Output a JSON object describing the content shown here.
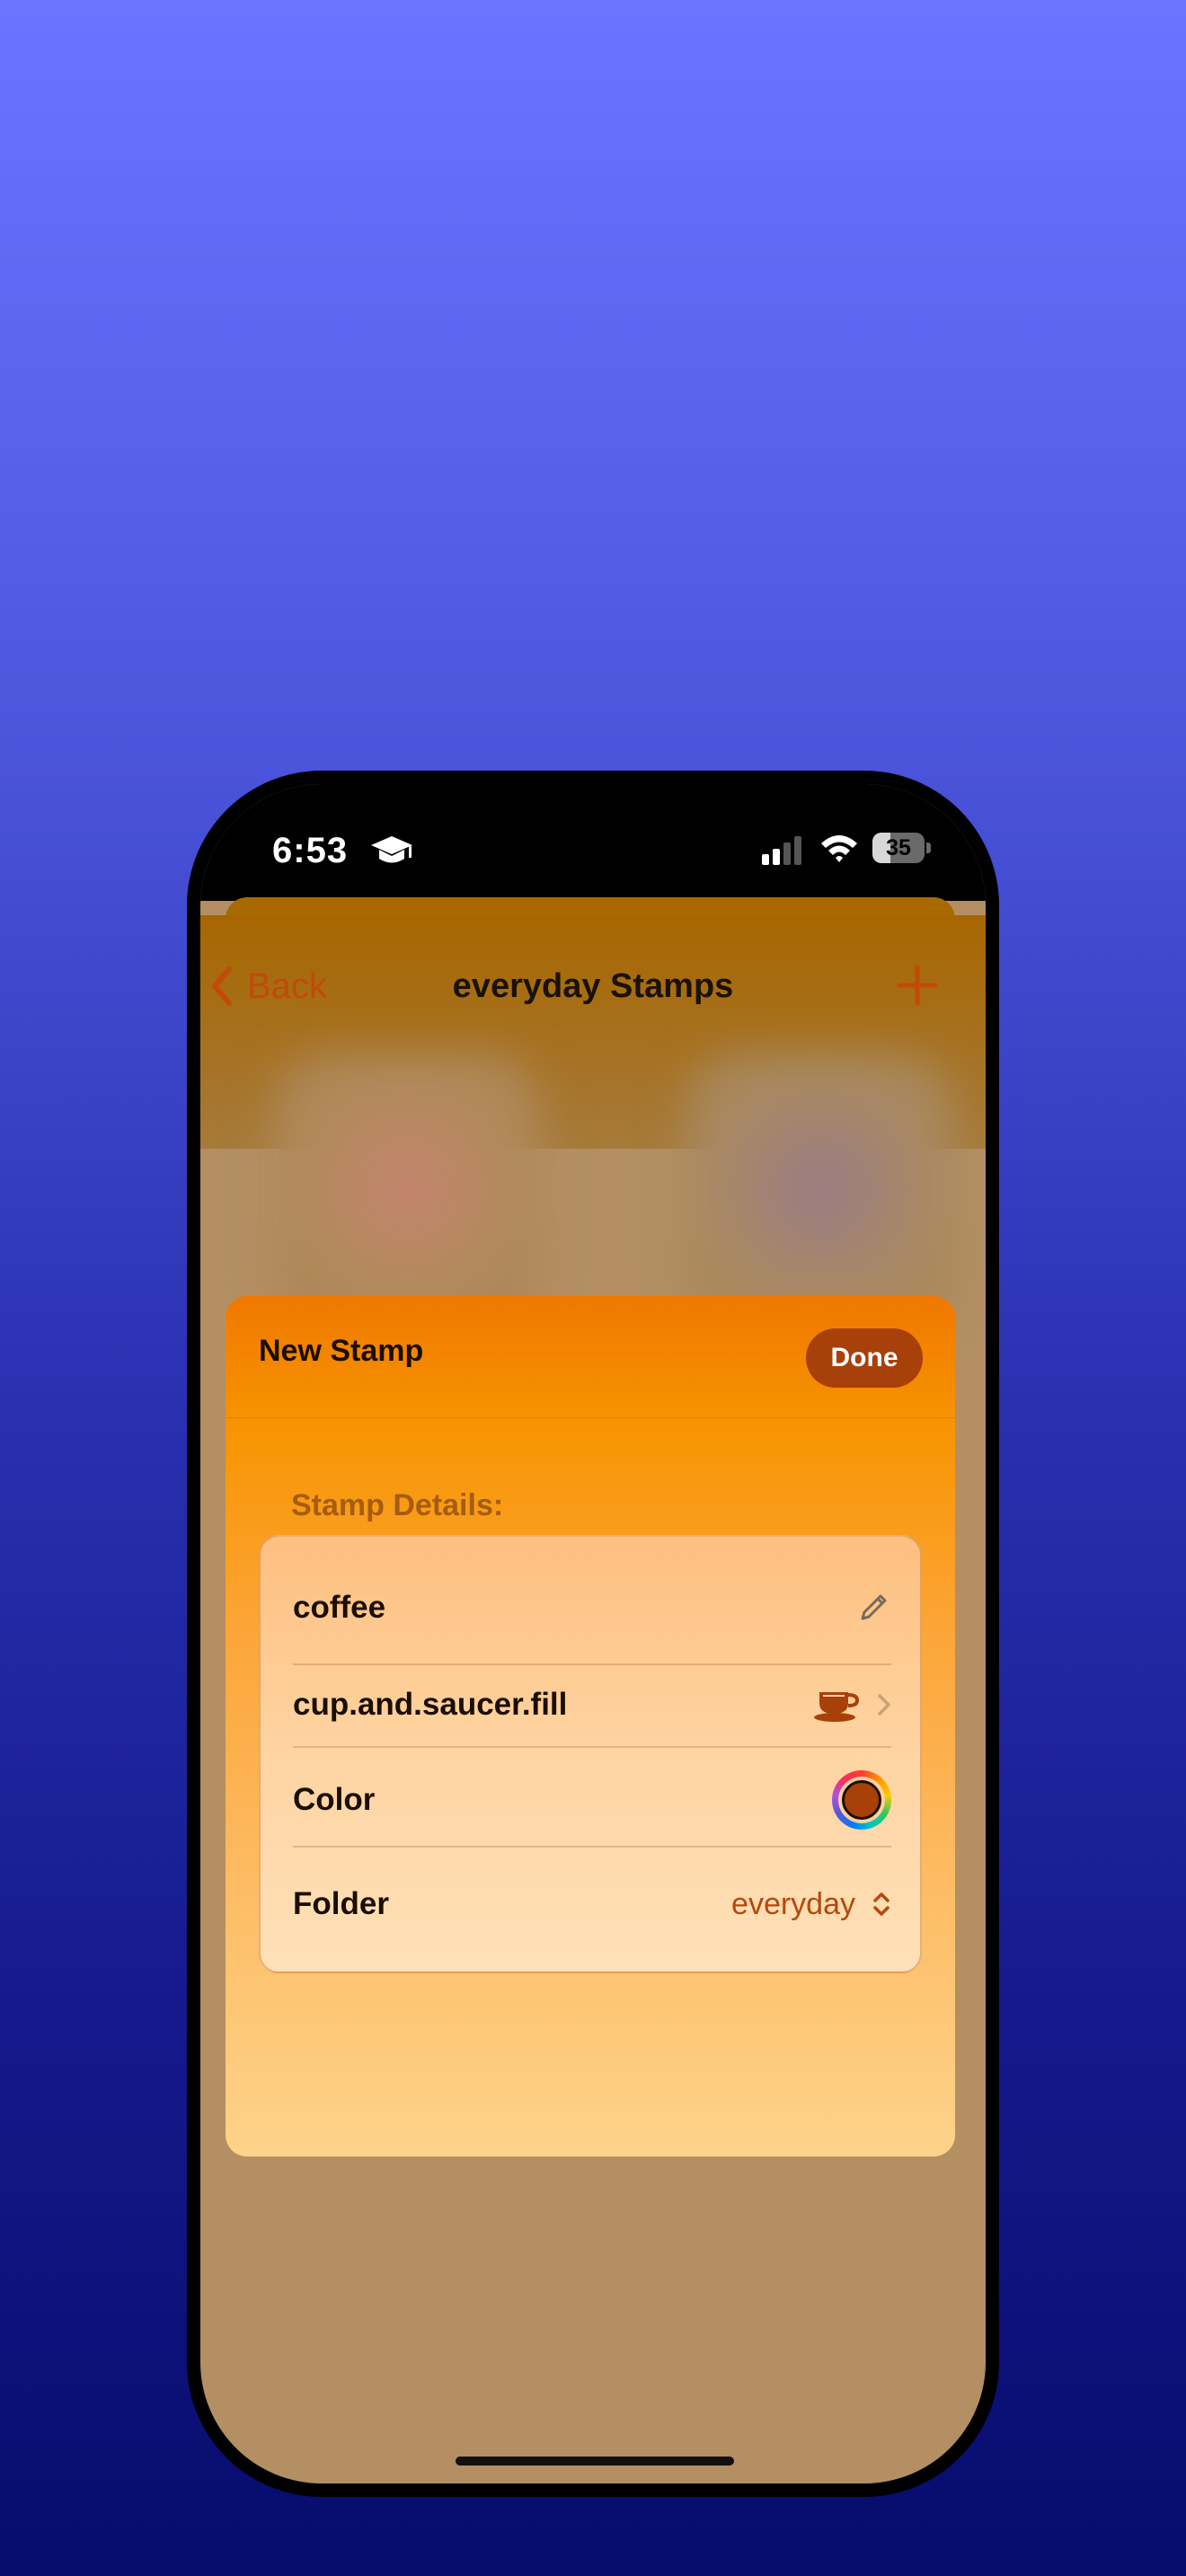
{
  "status_bar": {
    "time": "6:53",
    "battery_level": "35",
    "battery_fraction": 0.35,
    "icons": [
      "graduation-cap-icon",
      "cellular-signal-icon",
      "wifi-icon",
      "battery-icon"
    ]
  },
  "nav": {
    "back_label": "Back",
    "title": "everyday Stamps",
    "add_icon": "plus-icon"
  },
  "sheet": {
    "title": "New Stamp",
    "done_label": "Done",
    "section_label": "Stamp Details:",
    "rows": {
      "name": {
        "value": "coffee",
        "icon": "pencil-icon"
      },
      "symbol": {
        "value": "cup.and.saucer.fill",
        "icon": "cup-and-saucer-icon"
      },
      "color": {
        "label": "Color",
        "value_color": "#a8400a"
      },
      "folder": {
        "label": "Folder",
        "value": "everyday",
        "icon": "up-down-chevron-icon"
      }
    }
  },
  "colors": {
    "accent": "#a8400a",
    "accent_text": "#b5480c",
    "sheet_top": "#f07800",
    "sheet_bottom": "#fdd38a",
    "background_top": "#6a74ff",
    "background_bottom": "#060c6c"
  }
}
